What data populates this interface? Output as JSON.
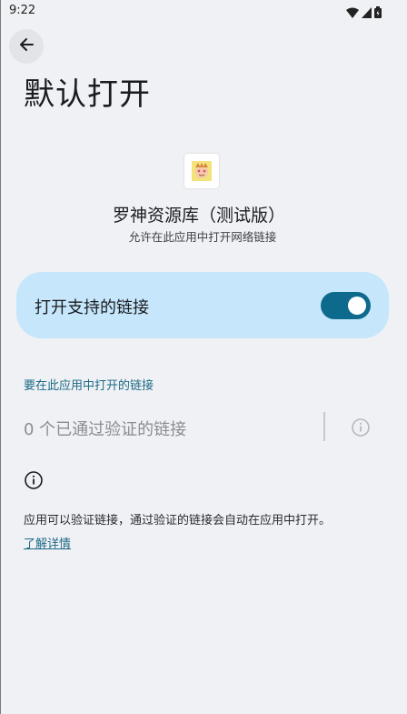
{
  "status_bar": {
    "time": "9:22"
  },
  "header": {
    "title": "默认打开"
  },
  "app": {
    "name": "罗神资源库（测试版）",
    "subtitle": "允许在此应用中打开网络链接"
  },
  "toggle": {
    "label": "打开支持的链接",
    "checked": true
  },
  "links_section": {
    "title": "要在此应用中打开的链接",
    "verified_links": "0 个已通过验证的链接"
  },
  "info": {
    "description": "应用可以验证链接，通过验证的链接会自动在应用中打开。",
    "learn_more": "了解详情"
  },
  "colors": {
    "accent": "#0d6a8d",
    "card_bg": "#c5e6fb",
    "link": "#1b6a86",
    "background": "#f0f1f4"
  }
}
